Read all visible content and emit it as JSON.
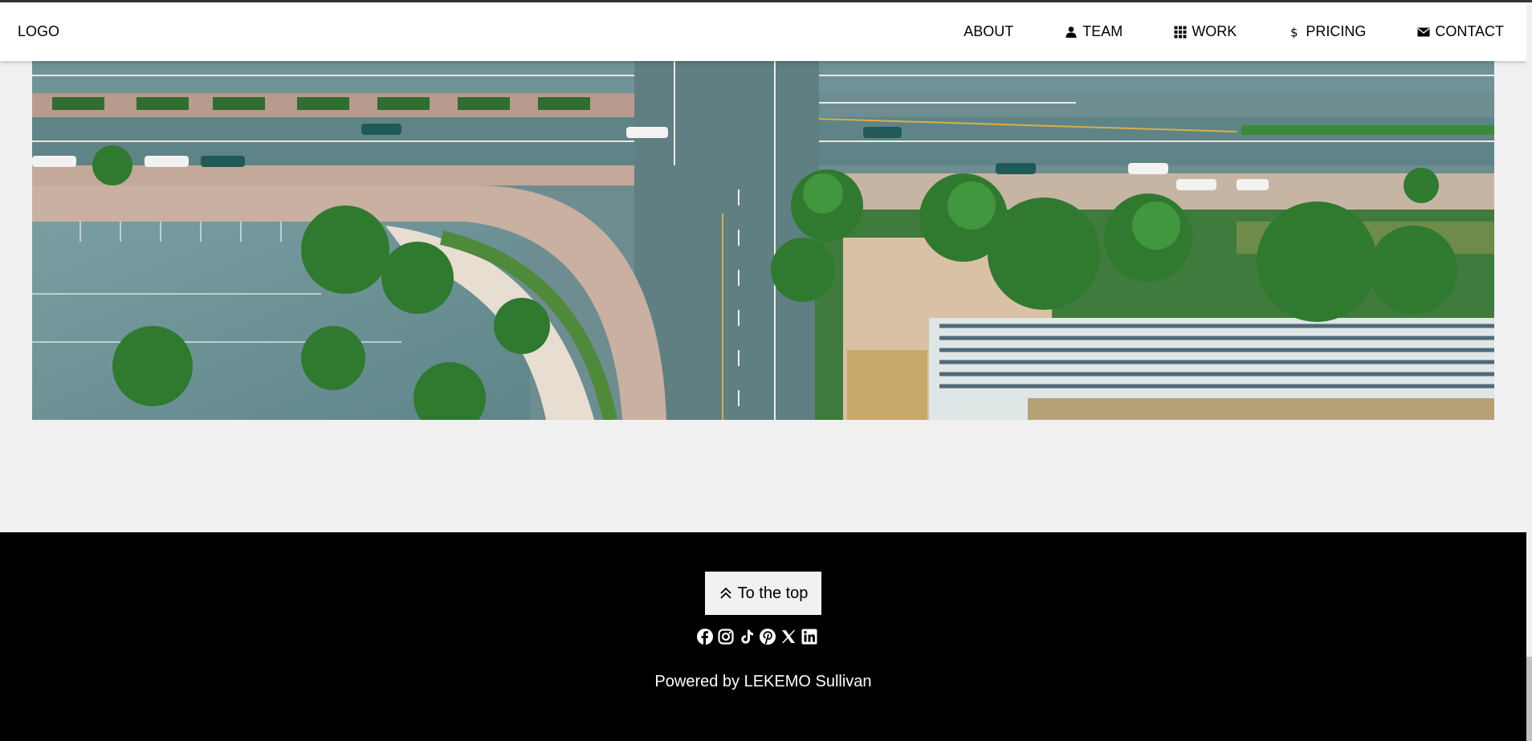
{
  "nav": {
    "logo": "LOGO",
    "items": [
      {
        "label": "ABOUT",
        "icon": ""
      },
      {
        "label": "TEAM",
        "icon": "user-icon"
      },
      {
        "label": "WORK",
        "icon": "grid-icon"
      },
      {
        "label": "PRICING",
        "icon": "dollar-icon"
      },
      {
        "label": "CONTACT",
        "icon": "envelope-icon"
      }
    ]
  },
  "footer": {
    "to_top_label": "To the top",
    "to_top_icon": "double-chevron-up-icon",
    "social_icons": [
      "facebook-icon",
      "instagram-icon",
      "tiktok-icon",
      "pinterest-icon",
      "x-icon",
      "linkedin-icon"
    ],
    "powered_by": "Powered by LEKEMO Sullivan"
  },
  "colors": {
    "navbar_bg": "#ffffff",
    "page_bg": "#f0f0f0",
    "footer_bg": "#000000",
    "button_bg": "#f1f1f1"
  }
}
